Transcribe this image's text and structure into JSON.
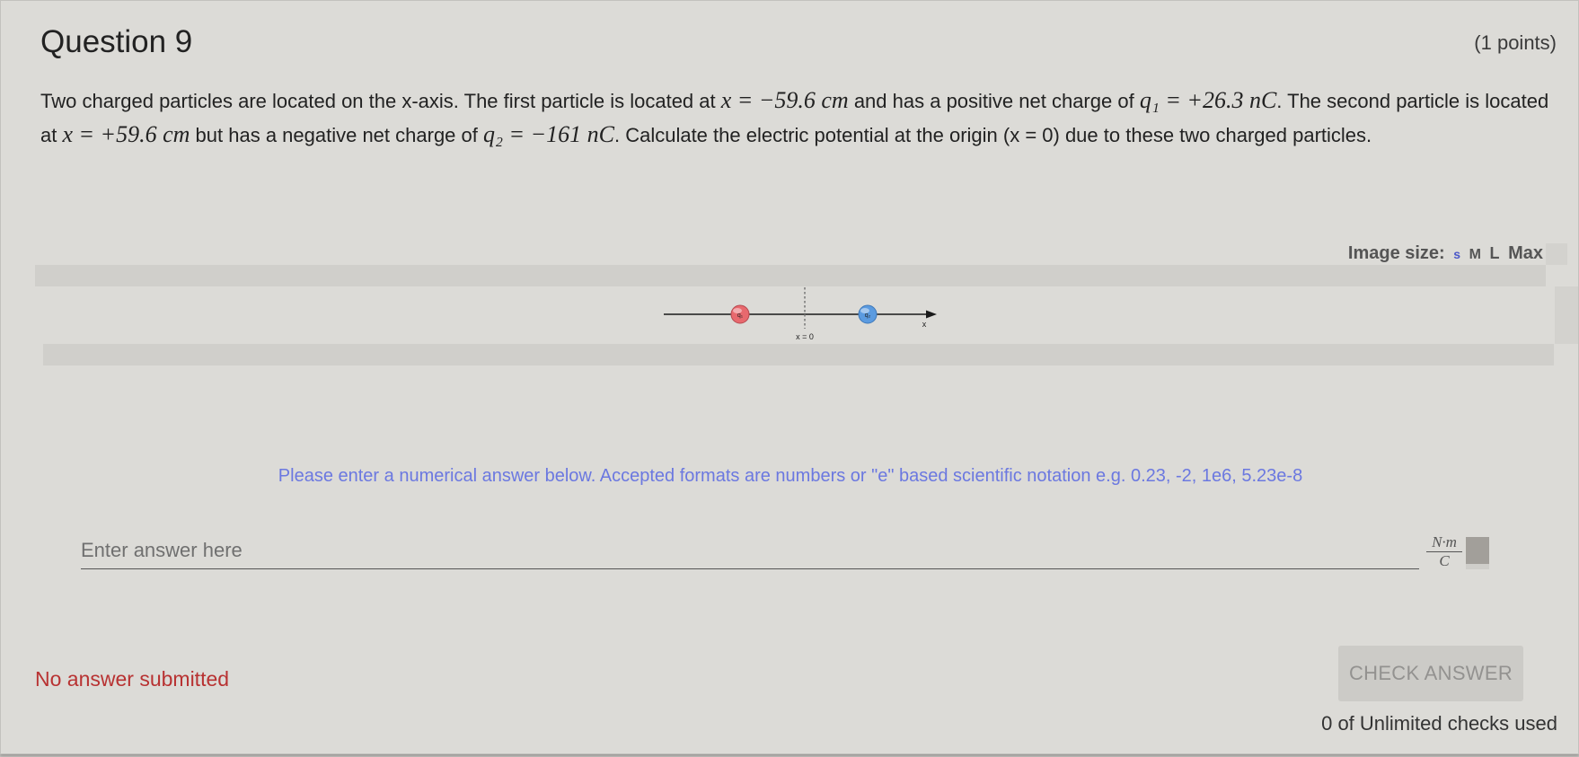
{
  "question": {
    "title": "Question 9",
    "points": "(1 points)",
    "text": {
      "p1": "Two charged particles are located on the x-axis.  The first particle is located at ",
      "m1": "x = −59.6 cm",
      "p2": " and has a positive net charge of ",
      "m2": "q₁ = +26.3 nC",
      "p3": ".  The second particle is located at ",
      "m3": "x = +59.6 cm",
      "p4": " but has a negative net charge of ",
      "m4": "q₂ = −161 nC",
      "p5": ".  Calculate the electric potential at the origin (x = 0) due to these two charged particles."
    }
  },
  "image_size": {
    "label": "Image size:",
    "options": [
      "s",
      "M",
      "L",
      "Max"
    ]
  },
  "figure": {
    "q1_label": "q₁",
    "q2_label": "q₂",
    "origin_label": "x = 0",
    "axis_label": "x",
    "q1_color": "#e8696e",
    "q2_color": "#5b9be0"
  },
  "answer": {
    "hint": "Please enter a numerical answer below. Accepted formats are numbers or \"e\" based scientific notation e.g. 0.23, -2, 1e6, 5.23e-8",
    "placeholder": "Enter answer here",
    "value": "",
    "unit_numerator": "N·m",
    "unit_denominator": "C"
  },
  "status": {
    "text": "No answer submitted",
    "color": "#b83232"
  },
  "check_button": {
    "label": "CHECK ANSWER"
  },
  "checks_used": "0 of Unlimited checks used"
}
